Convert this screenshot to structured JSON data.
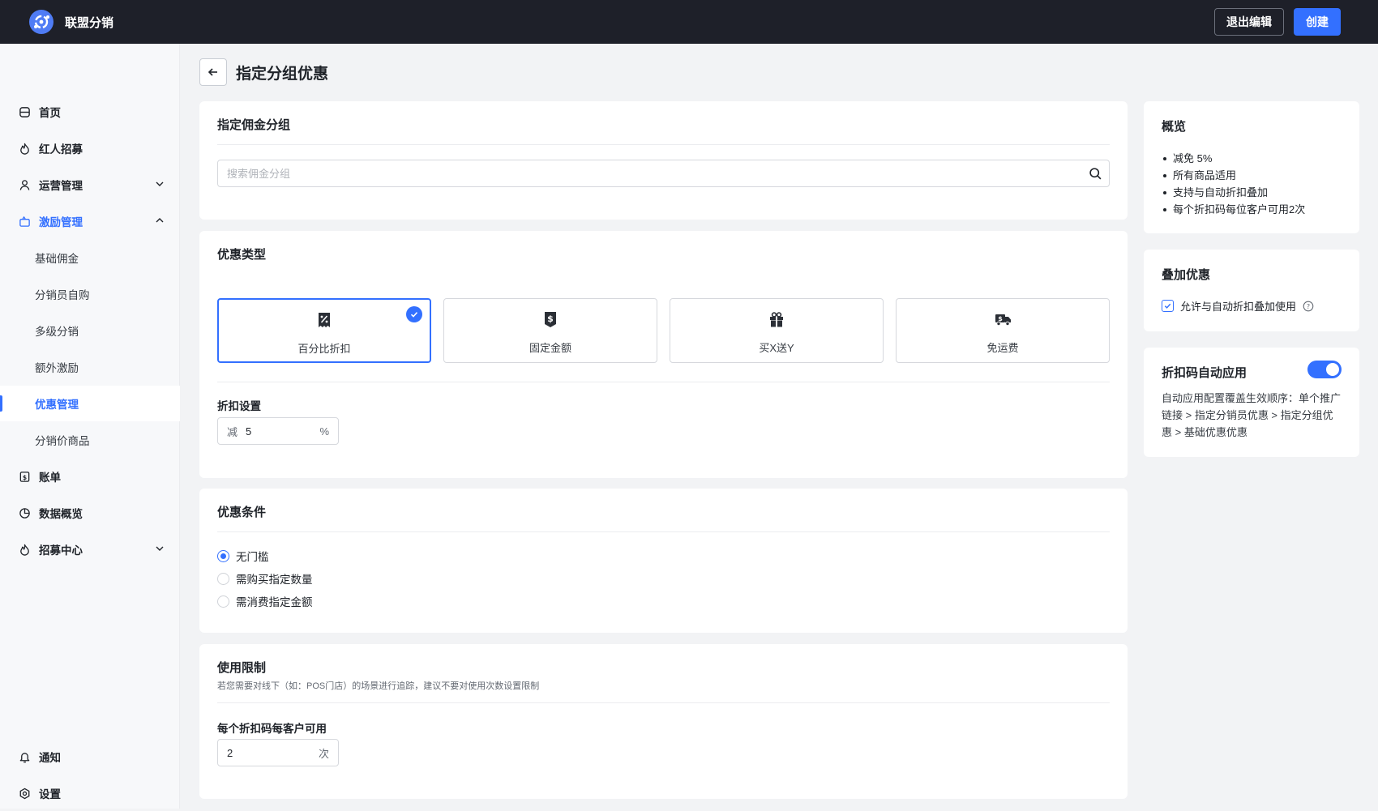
{
  "topbar": {
    "brand": "联盟分销",
    "exit_label": "退出编辑",
    "create_label": "创建"
  },
  "sidebar": {
    "items": [
      {
        "label": "首页",
        "icon": "home-icon"
      },
      {
        "label": "红人招募",
        "icon": "flame-icon"
      },
      {
        "label": "运营管理",
        "icon": "user-icon"
      },
      {
        "label": "激励管理",
        "icon": "gift-box-icon"
      },
      {
        "label": "基础佣金"
      },
      {
        "label": "分销员自购"
      },
      {
        "label": "多级分销"
      },
      {
        "label": "额外激励"
      },
      {
        "label": "优惠管理"
      },
      {
        "label": "分销价商品"
      },
      {
        "label": "账单",
        "icon": "bill-icon"
      },
      {
        "label": "数据概览",
        "icon": "pie-chart-icon"
      },
      {
        "label": "招募中心",
        "icon": "flame-icon"
      },
      {
        "label": "通知",
        "icon": "bell-icon"
      },
      {
        "label": "设置",
        "icon": "settings-icon"
      }
    ],
    "active": "优惠管理"
  },
  "page": {
    "title": "指定分组优惠"
  },
  "group_card": {
    "title": "指定佣金分组",
    "search_placeholder": "搜索佣金分组"
  },
  "type_card": {
    "title": "优惠类型",
    "options": [
      {
        "label": "百分比折扣",
        "icon": "percent-tag-icon"
      },
      {
        "label": "固定金额",
        "icon": "dollar-tag-icon"
      },
      {
        "label": "买X送Y",
        "icon": "gift-icon"
      },
      {
        "label": "免运费",
        "icon": "truck-icon"
      }
    ],
    "selected": "百分比折扣",
    "discount_label": "折扣设置",
    "discount_prefix": "减",
    "discount_value": "5",
    "discount_suffix": "%"
  },
  "condition_card": {
    "title": "优惠条件",
    "options": [
      "无门槛",
      "需购买指定数量",
      "需消费指定金额"
    ],
    "selected": "无门槛"
  },
  "limit_card": {
    "title": "使用限制",
    "hint": "若您需要对线下（如：POS门店）的场景进行追踪，建议不要对使用次数设置限制",
    "per_customer_label": "每个折扣码每客户可用",
    "per_customer_value": "2",
    "per_customer_suffix": "次"
  },
  "overview": {
    "title": "概览",
    "items": [
      "减免 5%",
      "所有商品适用",
      "支持与自动折扣叠加",
      "每个折扣码每位客户可用2次"
    ]
  },
  "stack": {
    "title": "叠加优惠",
    "checkbox_label": "允许与自动折扣叠加使用",
    "checked": true
  },
  "auto_apply": {
    "title": "折扣码自动应用",
    "enabled": true,
    "desc": "自动应用配置覆盖生效顺序：单个推广链接 > 指定分销员优惠 > 指定分组优惠 > 基础优惠优惠"
  },
  "colors": {
    "accent": "#3370ff",
    "topbar": "#1e2029"
  }
}
